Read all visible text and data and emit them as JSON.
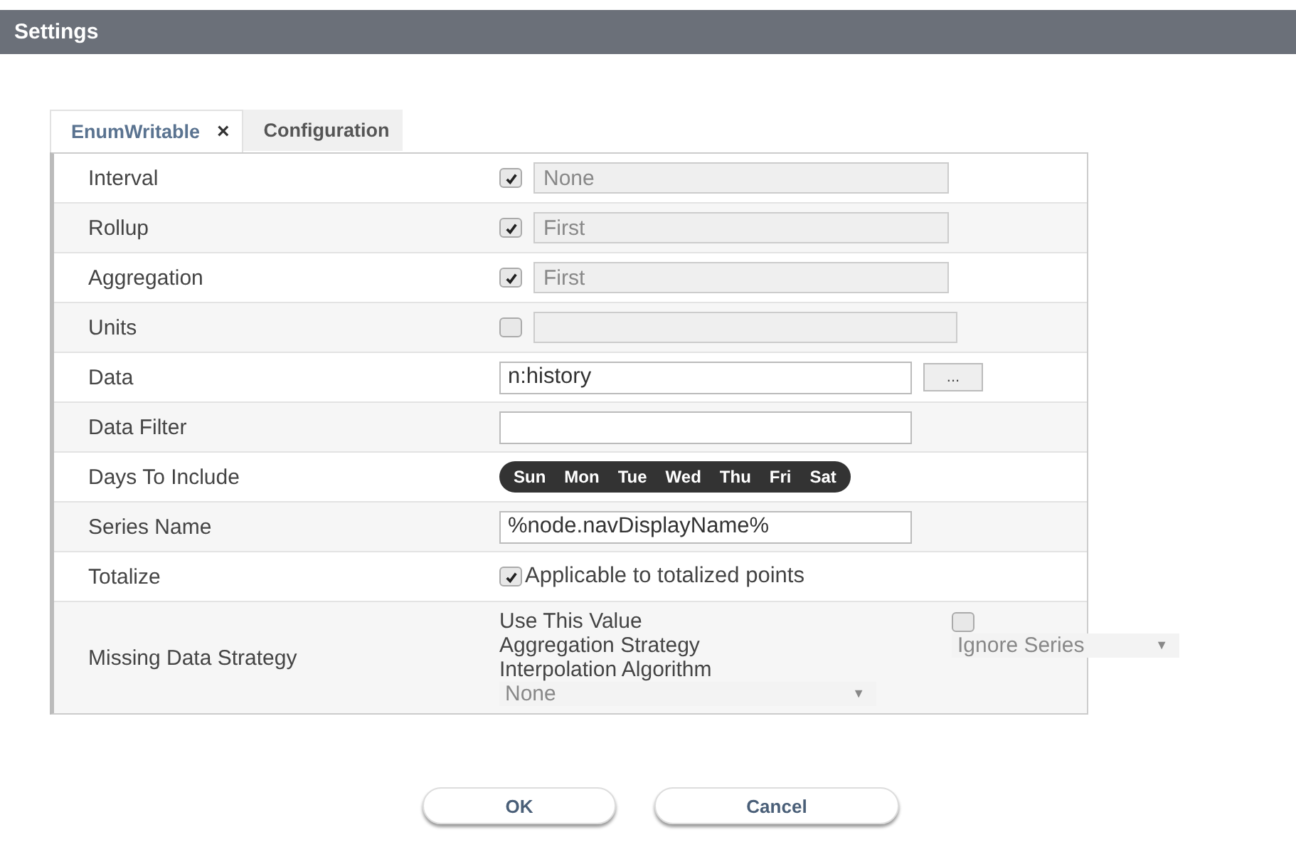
{
  "window": {
    "title": "Settings"
  },
  "tabs": [
    {
      "label": "EnumWritable",
      "selected": true,
      "close": "×"
    },
    {
      "label": "Configuration",
      "selected": false
    }
  ],
  "rows": [
    {
      "label": "Interval",
      "kind": "check-field",
      "checked": true,
      "value": "None"
    },
    {
      "label": "Rollup",
      "kind": "check-field",
      "checked": true,
      "value": "First"
    },
    {
      "label": "Aggregation",
      "kind": "check-field",
      "checked": true,
      "value": "First"
    },
    {
      "label": "Units",
      "kind": "check-field",
      "checked": false
    },
    {
      "label": "Data",
      "kind": "field-button",
      "value": "n:history",
      "button": "..."
    },
    {
      "label": "Data Filter",
      "kind": "field"
    },
    {
      "label": "Days To Include",
      "kind": "days",
      "days": [
        "Sun",
        "Mon",
        "Tue",
        "Wed",
        "Thu",
        "Fri",
        "Sat"
      ]
    },
    {
      "label": "Series Name",
      "kind": "field",
      "value": "%node.navDisplayName%"
    },
    {
      "label": "Totalize",
      "kind": "check-label",
      "checked": true,
      "text": "Applicable to totalized points"
    },
    {
      "label": "Missing Data Strategy",
      "kind": "missing",
      "use_value_label": "Use This Value",
      "use_value_checked": false,
      "aggregation_label": "Aggregation Strategy",
      "aggregation_value": "Ignore Series",
      "aggregation_arrow": "▼",
      "interpolation_label": "Interpolation Algorithm",
      "interpolation_value": "None",
      "interpolation_arrow": "▼"
    }
  ],
  "buttons": [
    "OK",
    "Cancel"
  ]
}
